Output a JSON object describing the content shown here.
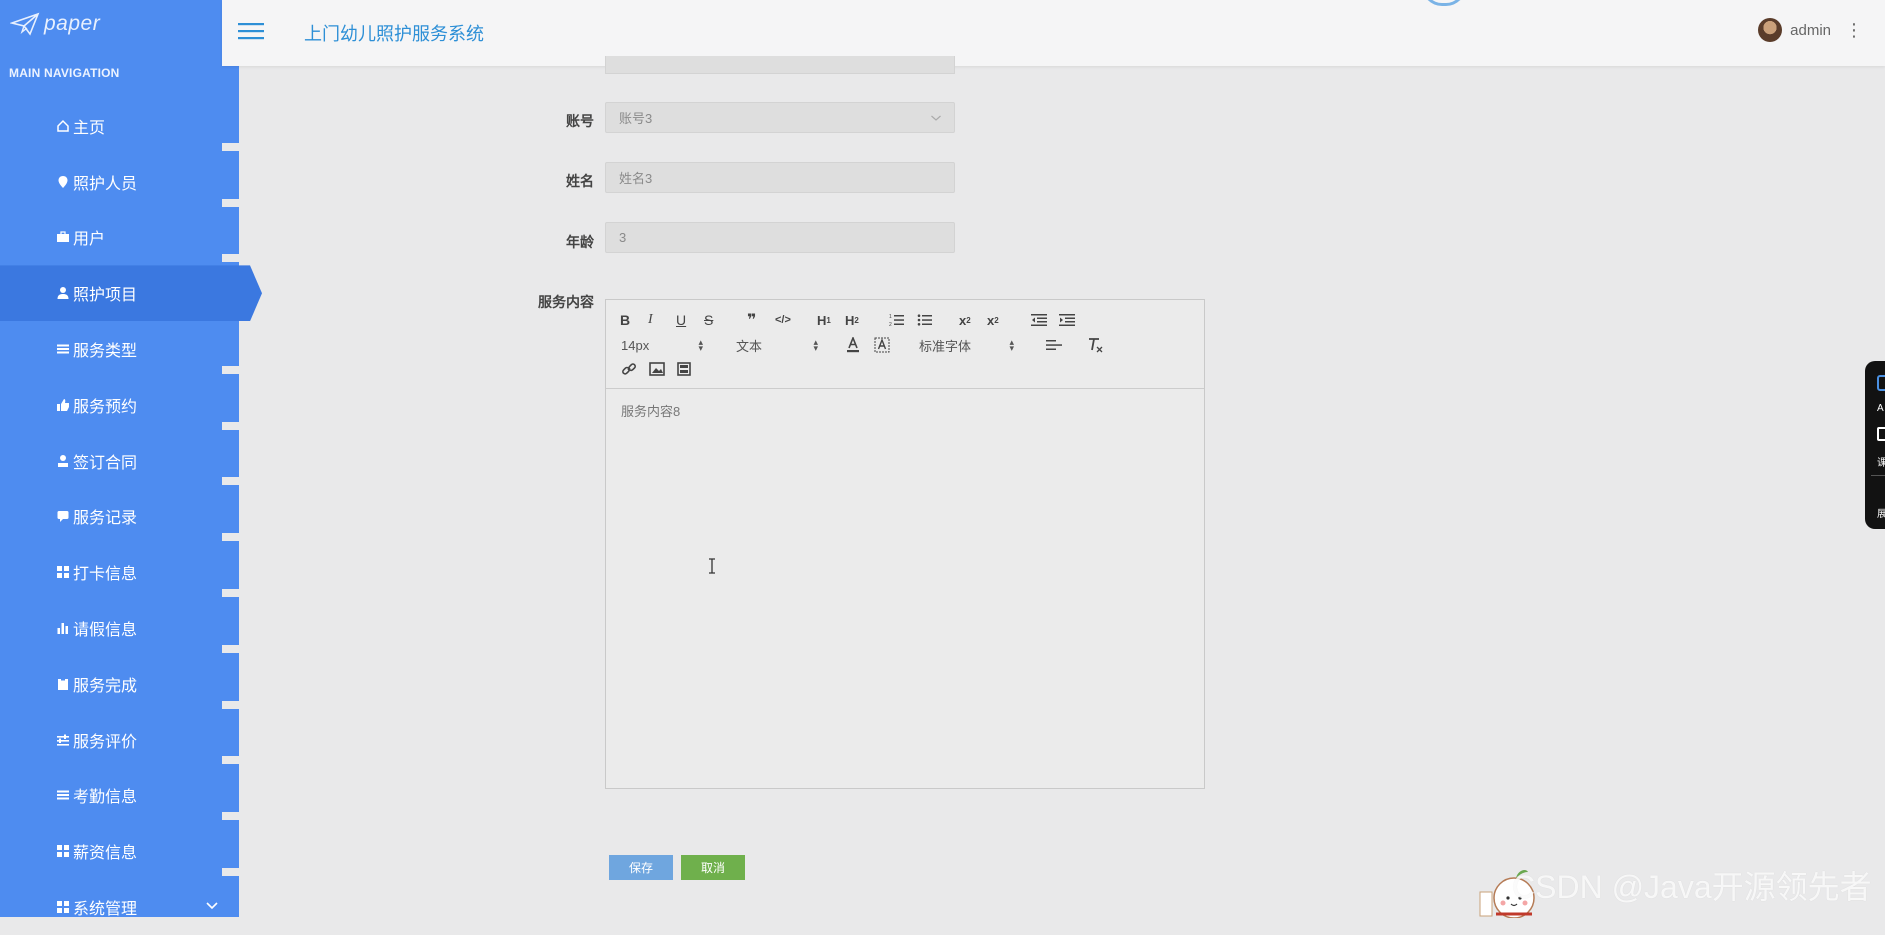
{
  "colors": {
    "sidebar": "#4e8cf0",
    "sidebar_active": "#3b78e0",
    "title": "#2d8fd6",
    "save": "#6fa6df",
    "cancel": "#6fb04c"
  },
  "logo": {
    "text": "paper",
    "icon": "paper-plane-icon"
  },
  "sidebar": {
    "heading": "MAIN NAVIGATION",
    "items": [
      {
        "label": "主页",
        "icon": "home-icon"
      },
      {
        "label": "照护人员",
        "icon": "map-pin-icon"
      },
      {
        "label": "用户",
        "icon": "briefcase-icon"
      },
      {
        "label": "照护项目",
        "icon": "user-icon",
        "active": true
      },
      {
        "label": "服务类型",
        "icon": "list-icon"
      },
      {
        "label": "服务预约",
        "icon": "thumbs-up-icon"
      },
      {
        "label": "签订合同",
        "icon": "user-stamp-icon"
      },
      {
        "label": "服务记录",
        "icon": "chat-icon"
      },
      {
        "label": "打卡信息",
        "icon": "grid-icon"
      },
      {
        "label": "请假信息",
        "icon": "bar-chart-icon"
      },
      {
        "label": "服务完成",
        "icon": "clipboard-icon"
      },
      {
        "label": "服务评价",
        "icon": "sliders-icon"
      },
      {
        "label": "考勤信息",
        "icon": "list-icon"
      },
      {
        "label": "薪资信息",
        "icon": "grid-icon"
      },
      {
        "label": "系统管理",
        "icon": "grid-icon"
      }
    ]
  },
  "header": {
    "title": "上门幼儿照护服务系统",
    "username": "admin"
  },
  "form": {
    "account": {
      "label": "账号",
      "value": "账号3"
    },
    "name": {
      "label": "姓名",
      "value": "姓名3"
    },
    "age": {
      "label": "年龄",
      "value": "3"
    },
    "content": {
      "label": "服务内容",
      "value": "服务内容8"
    }
  },
  "editor": {
    "font_size": "14px",
    "block_type": "文本",
    "font_family": "标准字体"
  },
  "buttons": {
    "save": "保存",
    "cancel": "取消"
  },
  "watermark": "CSDN @Java开源领先者",
  "float_panel": {
    "items": [
      "A",
      "课",
      "展"
    ]
  }
}
